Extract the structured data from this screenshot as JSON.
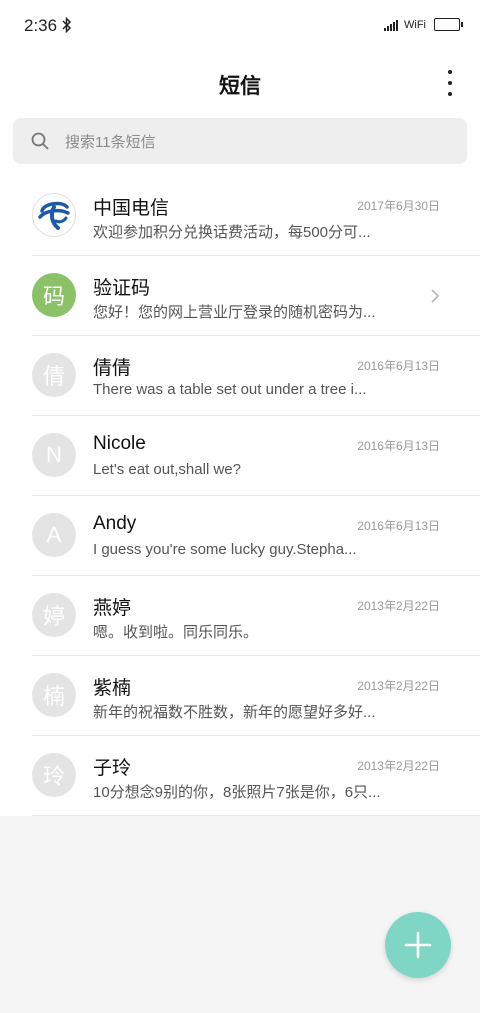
{
  "status_bar": {
    "time": "2:36",
    "bluetooth_icon": "bluetooth-icon",
    "network_label": "WiFi",
    "battery_icon": "battery-full-icon"
  },
  "app_bar": {
    "title": "短信",
    "menu_icon": "more-vertical-icon"
  },
  "search": {
    "placeholder": "搜索11条短信",
    "icon": "search-icon"
  },
  "conversations": [
    {
      "name": "中国电信",
      "preview": "欢迎参加积分兑换话费活动，每500分可...",
      "date": "2017年6月30日",
      "avatar_type": "logo"
    },
    {
      "name": "验证码",
      "preview": "您好！您的网上营业厅登录的随机密码为...",
      "avatar_text": "码",
      "avatar_color": "#8bc267",
      "trailing_icon": "chevron-right-icon"
    },
    {
      "name": "倩倩",
      "preview": "There was a table set out under a tree i...",
      "date": "2016年6月13日",
      "avatar_text": "倩"
    },
    {
      "name": "Nicole",
      "preview": "Let's eat out,shall we?",
      "date": "2016年6月13日",
      "avatar_text": "N"
    },
    {
      "name": "Andy",
      "preview": "I guess you're some lucky guy.Stepha...",
      "date": "2016年6月13日",
      "avatar_text": "A"
    },
    {
      "name": "燕婷",
      "preview": "嗯。收到啦。同乐同乐。",
      "date": "2013年2月22日",
      "avatar_text": "婷"
    },
    {
      "name": "紫楠",
      "preview": "新年的祝福数不胜数，新年的愿望好多好...",
      "date": "2013年2月22日",
      "avatar_text": "楠"
    },
    {
      "name": "子玲",
      "preview": "10分想念9别的你，8张照片7张是你，6只...",
      "date": "2013年2月22日",
      "avatar_text": "玲"
    }
  ],
  "fab": {
    "icon": "plus-icon",
    "color": "#7fd6c4"
  },
  "colors": {
    "accent": "#7fd6c4",
    "verify_avatar": "#8bc267",
    "placeholder_avatar": "#e4e4e4"
  }
}
